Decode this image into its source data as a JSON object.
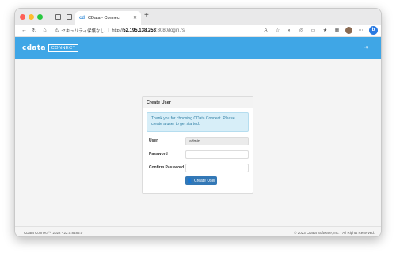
{
  "browser": {
    "tab_title": "CData - Connect",
    "tab_favicon": "cd",
    "new_tab": "+",
    "url_security_label": "セキュリティ保護なし",
    "url_prefix": "http://",
    "url_host": "52.195.138.253",
    "url_path": ":8080/login.rsl"
  },
  "app": {
    "logo_text": "cdata",
    "logo_badge": "CONNECT"
  },
  "card": {
    "title": "Create User",
    "alert": "Thank you for choosing CData Connect. Please create a user to get started.",
    "user_label": "User",
    "user_value": "admin",
    "password_label": "Password",
    "password_value": "",
    "confirm_label": "Confirm Password",
    "confirm_value": "",
    "button_label": "Create User"
  },
  "footer": {
    "left": "CData Connect™ 2022 - 22.0.8486.0",
    "right": "© 2023 CData Software, Inc. - All Rights Reserved."
  },
  "colors": {
    "header": "#3fa6e6",
    "button": "#3378b6",
    "alert_bg": "#d7eef8",
    "alert_text": "#2e7ea3"
  },
  "icons": [
    "close-dot",
    "minimize-dot",
    "maximize-dot",
    "back-icon",
    "refresh-icon",
    "home-icon",
    "warning-icon",
    "signout-icon",
    "add-user-icon"
  ]
}
